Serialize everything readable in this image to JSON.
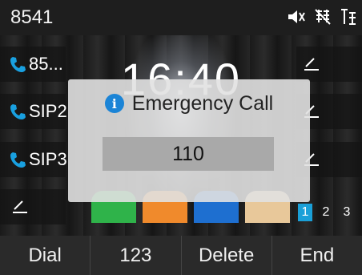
{
  "status": {
    "account": "8541",
    "icons": [
      "mute-icon",
      "network-off-icon",
      "lan-icon"
    ]
  },
  "line_keys": [
    {
      "label": "85...",
      "icon": "phone-icon"
    },
    {
      "label": "SIP2",
      "icon": "phone-icon"
    },
    {
      "label": "SIP3",
      "icon": "phone-icon"
    }
  ],
  "clock": {
    "time": "16:40"
  },
  "dialog": {
    "title": "Emergency Call",
    "icon": "info-icon",
    "number": "110"
  },
  "pages": [
    "1",
    "2",
    "3"
  ],
  "softkeys": [
    "Dial",
    "123",
    "Delete",
    "End"
  ],
  "colors": {
    "accent": "#1b84d6",
    "page_active": "#1aa0d8",
    "call_green": "#2fb34a"
  }
}
